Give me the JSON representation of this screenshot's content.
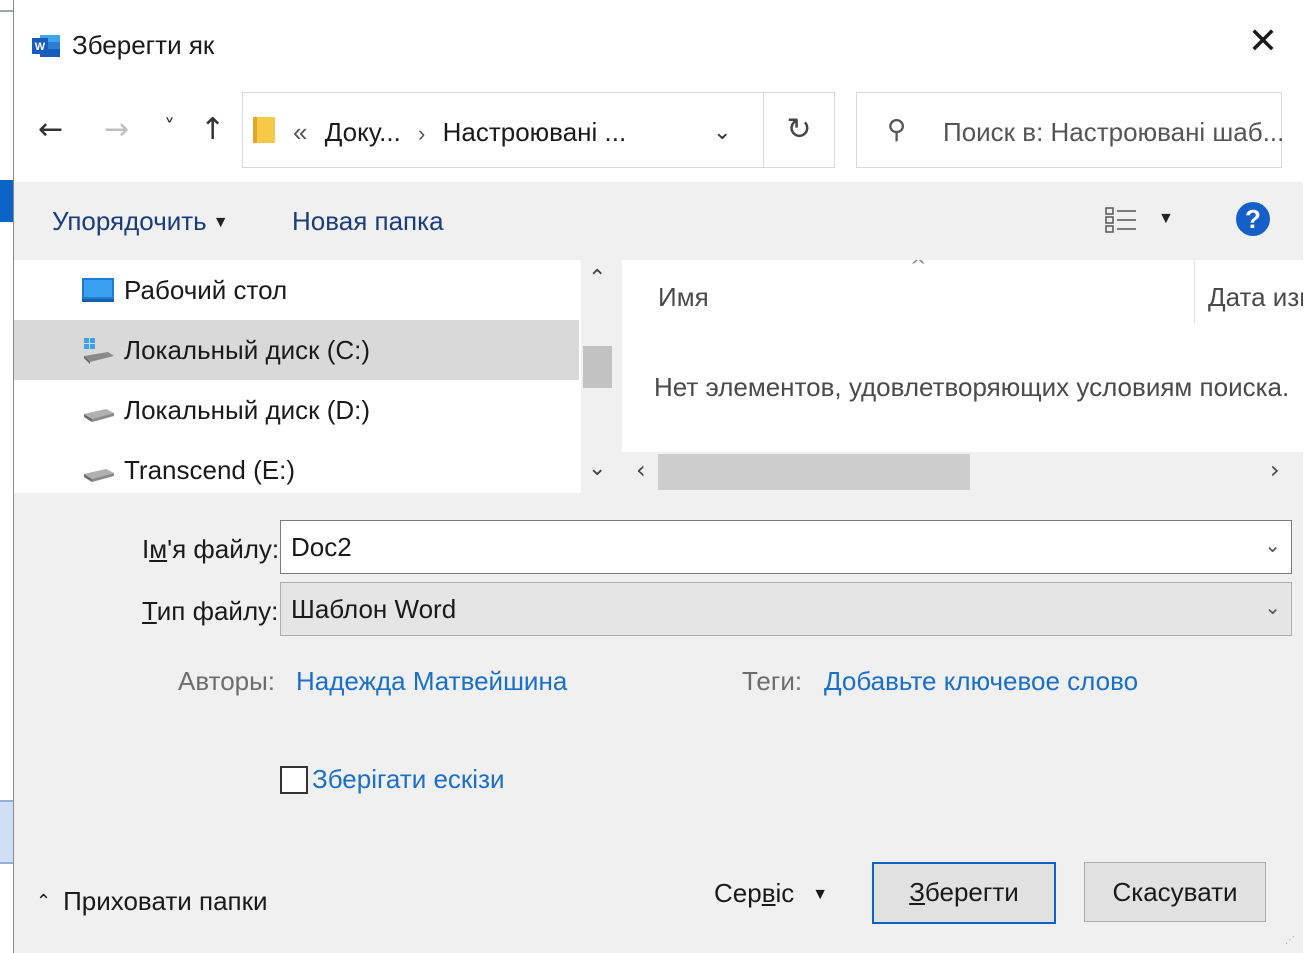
{
  "window": {
    "title": "Зберегти як",
    "close_icon": "close-icon",
    "app_icon": "word-icon"
  },
  "navigation": {
    "back_icon": "←",
    "forward_icon": "→",
    "recent_icon": "˅",
    "up_icon": "↑",
    "address": {
      "prefix": "«",
      "crumb_1": "Доку...",
      "separator": "›",
      "crumb_2": "Настроювані ...",
      "dropdown_icon": "chevron-down-icon",
      "refresh_icon": "refresh-icon"
    },
    "search": {
      "icon": "search-icon",
      "placeholder": "Поиск в: Настроювані шаб..."
    }
  },
  "toolbar": {
    "organize_label": "Упорядочить",
    "new_folder_label": "Новая папка",
    "view_icon": "view-options-icon",
    "help_icon": "help-icon",
    "help_glyph": "?"
  },
  "nav_pane": {
    "items": [
      {
        "label": "Рабочий стол",
        "icon": "desktop-icon",
        "selected": false
      },
      {
        "label": "Локальный диск (C:)",
        "icon": "system-drive-icon",
        "selected": true
      },
      {
        "label": "Локальный диск (D:)",
        "icon": "drive-icon",
        "selected": false
      },
      {
        "label": "Transcend (E:)",
        "icon": "drive-icon",
        "selected": false
      }
    ]
  },
  "file_list": {
    "columns": [
      "Имя",
      "Дата изм"
    ],
    "empty_message": "Нет элементов, удовлетворяющих условиям поиска."
  },
  "form": {
    "filename_label_pre": "І",
    "filename_label_u": "м",
    "filename_label_post": "'я файлу:",
    "filename_value": "Doc2",
    "filetype_label_u": "Т",
    "filetype_label_post": "ип файлу:",
    "filetype_value": "Шаблон Word",
    "authors_label": "Авторы:",
    "authors_value": "Надежда Матвейшина",
    "tags_label": "Теги:",
    "tags_value": "Добавьте ключевое слово",
    "thumbnail_label": "Зберігати ескізи",
    "thumbnail_checked": false
  },
  "footer": {
    "hide_folders_label": "Приховати папки",
    "service_label_pre": "Сер",
    "service_label_u": "в",
    "service_label_post": "іс",
    "save_label_u": "З",
    "save_label_post": "берегти",
    "cancel_label": "Скасувати"
  },
  "colors": {
    "accent": "#0a64c8",
    "link": "#1a6fc9",
    "help": "#1460c8"
  }
}
